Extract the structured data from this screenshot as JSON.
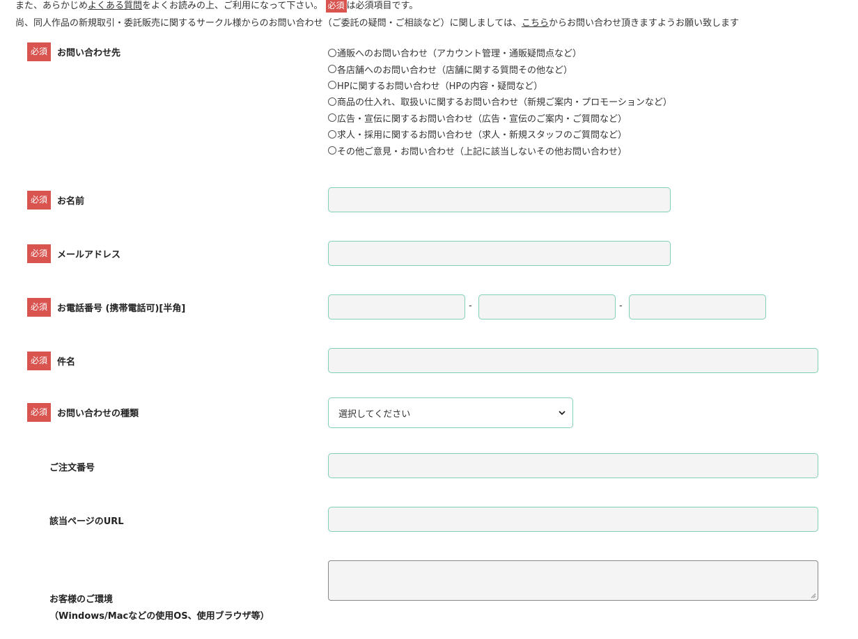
{
  "notice": {
    "line1_pre": "また、あらかじめ",
    "line1_link": "よくある質問",
    "line1_mid": "をよくお読みの上、ご利用になって下さい。",
    "line1_badge": "必須",
    "line1_post": "は必須項目です。",
    "line2_pre": "尚、同人作品の新規取引・委託販売に関するサークル様からのお問い合わせ（ご委託の疑問・ご相談など）に関しましては、",
    "line2_link": "こちら",
    "line2_post": "からお問い合わせ頂きますようお願い致します"
  },
  "required_badge": "必須",
  "colors": {
    "badge": "#d9534f",
    "input_border": "#7fd1b0",
    "input_bg": "#f4f4f4"
  },
  "form": {
    "inquiry_target": {
      "label": "お問い合わせ先",
      "options": [
        "通販へのお問い合わせ（アカウント管理・通販疑問点など）",
        "各店舗へのお問い合わせ（店舗に関する質問その他など）",
        "HPに関するお問い合わせ（HPの内容・疑問など）",
        "商品の仕入れ、取扱いに関するお問い合わせ（新規ご案内・プロモーションなど）",
        "広告・宣伝に関するお問い合わせ（広告・宣伝のご案内・ご質問など）",
        "求人・採用に関するお問い合わせ（求人・新規スタッフのご質問など）",
        "その他ご意見・お問い合わせ（上記に該当しないその他お問い合わせ）"
      ]
    },
    "name": {
      "label": "お名前",
      "value": ""
    },
    "email": {
      "label": "メールアドレス",
      "value": ""
    },
    "phone": {
      "label": "お電話番号 (携帯電話可)[半角]",
      "separator": "-"
    },
    "subject": {
      "label": "件名",
      "value": ""
    },
    "inquiry_type": {
      "label": "お問い合わせの種類",
      "selected": "選択してください"
    },
    "order_number": {
      "label": "ご注文番号",
      "value": ""
    },
    "page_url": {
      "label": "該当ページのURL",
      "value": ""
    },
    "environment": {
      "label": "お客様のご環境",
      "sub_label": "（Windows/Macなどの使用OS、使用ブラウザ等）"
    }
  }
}
